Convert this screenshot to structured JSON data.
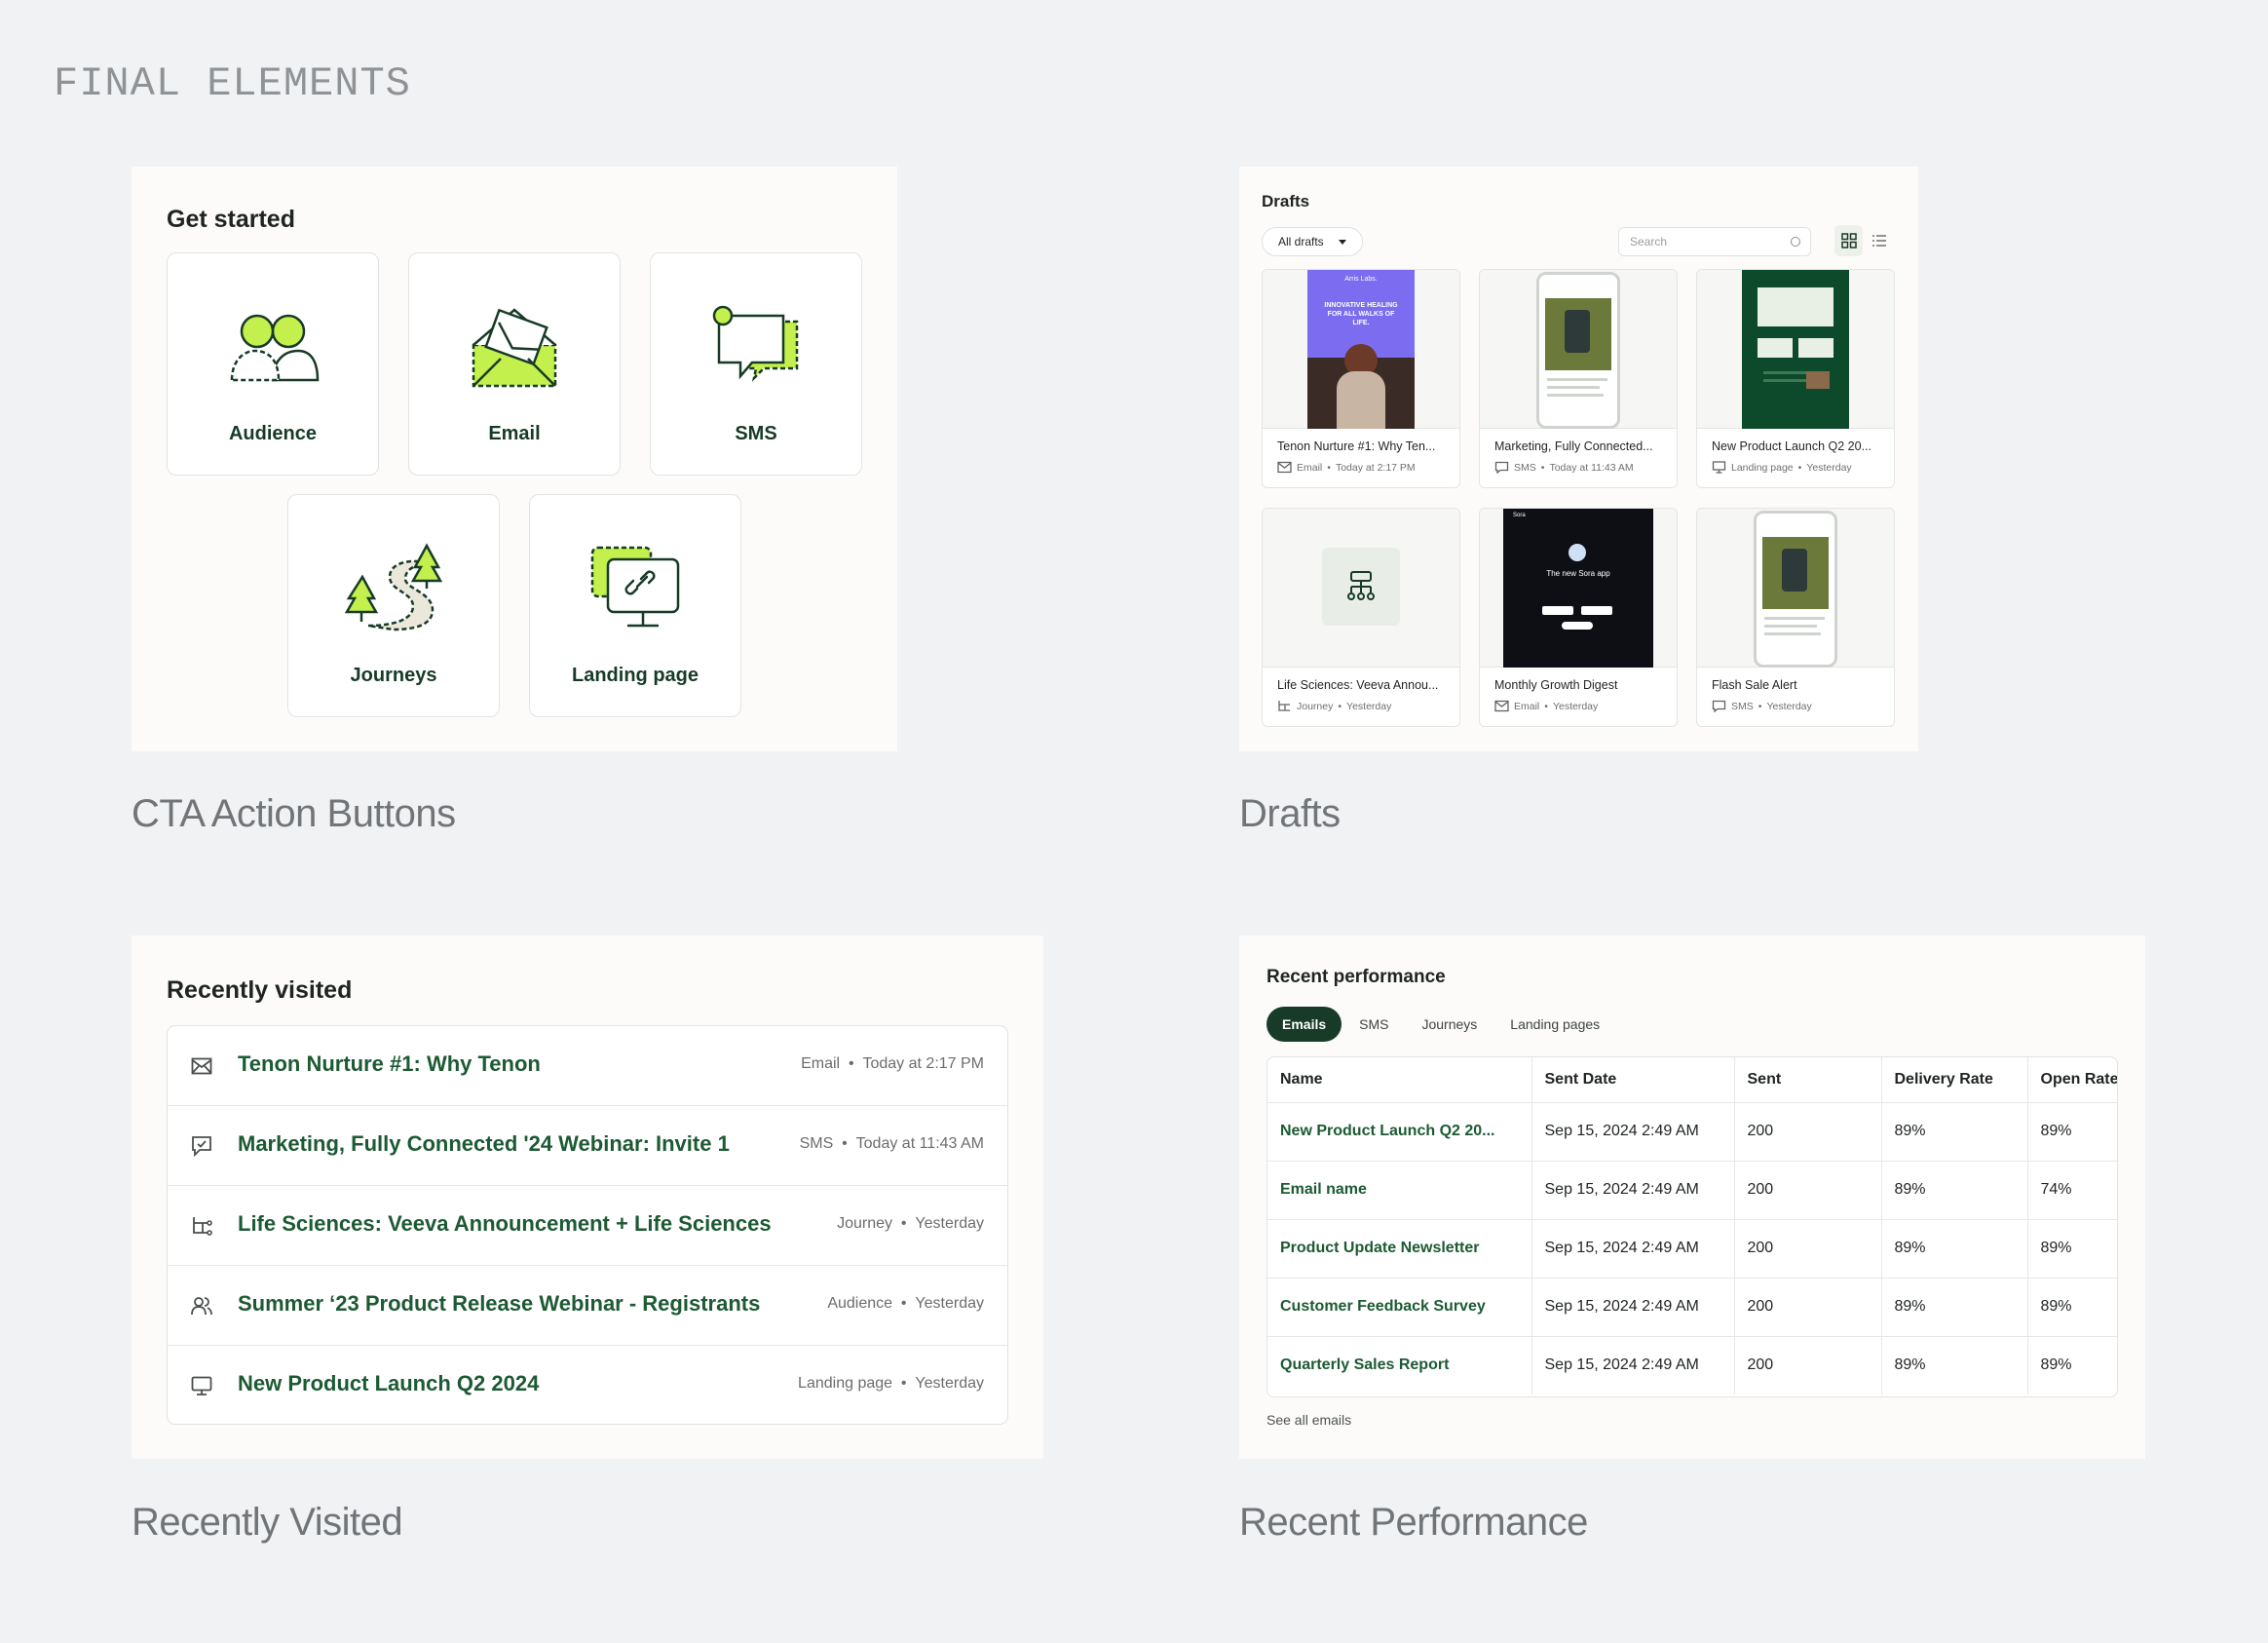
{
  "heading": "FINAL ELEMENTS",
  "get_started": {
    "title": "Get started",
    "caption": "CTA Action Buttons",
    "items": [
      {
        "label": "Audience",
        "icon": "audience-icon"
      },
      {
        "label": "Email",
        "icon": "email-icon"
      },
      {
        "label": "SMS",
        "icon": "sms-icon"
      },
      {
        "label": "Journeys",
        "icon": "journeys-icon"
      },
      {
        "label": "Landing page",
        "icon": "landing-page-icon"
      }
    ]
  },
  "drafts": {
    "title": "Drafts",
    "caption": "Drafts",
    "filter_label": "All drafts",
    "search_placeholder": "Search",
    "cards": [
      {
        "title": "Tenon Nurture #1: Why Ten...",
        "type": "Email",
        "time": "Today at 2:17 PM"
      },
      {
        "title": "Marketing, Fully Connected...",
        "type": "SMS",
        "time": "Today at 11:43 AM"
      },
      {
        "title": "New Product Launch Q2 20...",
        "type": "Landing page",
        "time": "Yesterday"
      },
      {
        "title": "Life Sciences: Veeva Annou...",
        "type": "Journey",
        "time": "Yesterday"
      },
      {
        "title": "Monthly Growth Digest",
        "type": "Email",
        "time": "Yesterday"
      },
      {
        "title": "Flash Sale Alert",
        "type": "SMS",
        "time": "Yesterday"
      }
    ],
    "thumb_text": {
      "brand": "Arris Labs.",
      "headline": "INNOVATIVE HEALING FOR ALL WALKS OF LIFE.",
      "sora_logo": "Sora",
      "sora_headline": "The new Sora app"
    }
  },
  "recently_visited": {
    "title": "Recently visited",
    "caption": "Recently Visited",
    "items": [
      {
        "name": "Tenon Nurture #1: Why Tenon",
        "type": "Email",
        "time": "Today at 2:17 PM"
      },
      {
        "name": "Marketing, Fully Connected '24 Webinar: Invite 1",
        "type": "SMS",
        "time": "Today at 11:43 AM"
      },
      {
        "name": "Life Sciences: Veeva Announcement + Life Sciences",
        "type": "Journey",
        "time": "Yesterday"
      },
      {
        "name": "Summer ‘23 Product Release Webinar - Registrants",
        "type": "Audience",
        "time": "Yesterday"
      },
      {
        "name": "New Product Launch Q2 2024",
        "type": "Landing page",
        "time": "Yesterday"
      }
    ]
  },
  "recent_performance": {
    "title": "Recent performance",
    "caption": "Recent Performance",
    "tabs": [
      "Emails",
      "SMS",
      "Journeys",
      "Landing pages"
    ],
    "columns": [
      "Name",
      "Sent Date",
      "Sent",
      "Delivery Rate",
      "Open Rate"
    ],
    "rows": [
      [
        "New Product Launch Q2 20...",
        "Sep 15, 2024 2:49 AM",
        "200",
        "89%",
        "89%"
      ],
      [
        "Email name",
        "Sep 15, 2024 2:49 AM",
        "200",
        "89%",
        "74%"
      ],
      [
        "Product Update Newsletter",
        "Sep 15, 2024 2:49 AM",
        "200",
        "89%",
        "89%"
      ],
      [
        "Customer Feedback Survey",
        "Sep 15, 2024 2:49 AM",
        "200",
        "89%",
        "89%"
      ],
      [
        "Quarterly Sales Report",
        "Sep 15, 2024 2:49 AM",
        "200",
        "89%",
        "89%"
      ]
    ],
    "see_all": "See all emails"
  },
  "colors": {
    "brand_dark": "#173b26",
    "link_green": "#1c5a33",
    "accent_lime": "#c4f04e"
  }
}
